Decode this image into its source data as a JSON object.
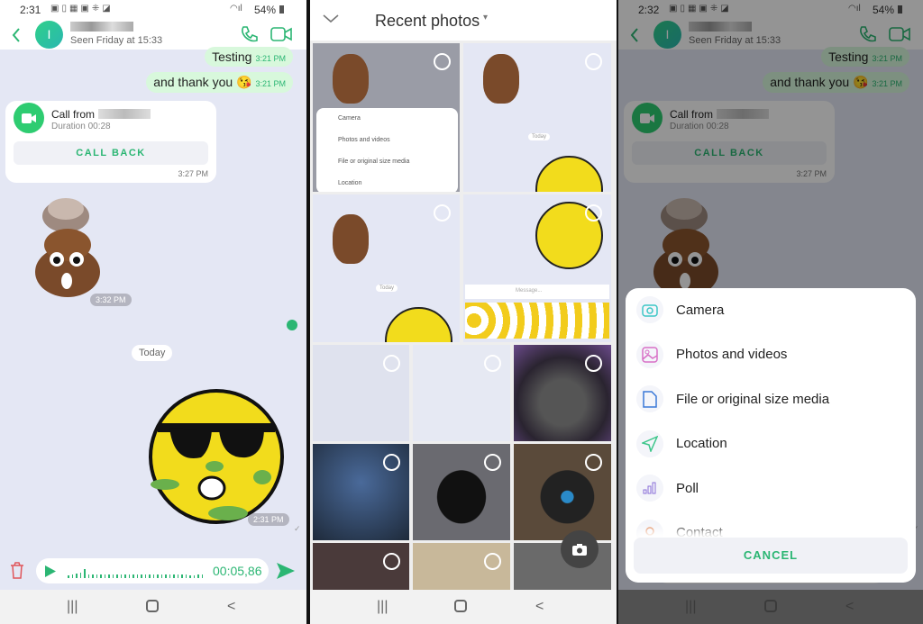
{
  "left": {
    "status": {
      "time": "2:31",
      "battery": "54%"
    },
    "header": {
      "avatar_letter": "I",
      "seen": "Seen Friday at 15:33"
    },
    "messages": [
      {
        "text": "Testing",
        "time": "3:21 PM"
      },
      {
        "text": "and thank you 😘",
        "time": "3:21 PM"
      }
    ],
    "call": {
      "title": "Call from",
      "duration": "Duration 00:28",
      "button": "CALL BACK",
      "time": "3:27 PM"
    },
    "sticker1_time": "3:32 PM",
    "date_divider": "Today",
    "sticker2_time": "2:31 PM",
    "composer": {
      "duration": "00:05,86"
    }
  },
  "middle": {
    "title": "Recent photos",
    "mini_menu": [
      "Camera",
      "Photos and videos",
      "File or original size media",
      "Location"
    ],
    "thumb_today": "Today",
    "thumb_message": "Message..."
  },
  "right": {
    "status": {
      "time": "2:32",
      "battery": "54%"
    },
    "sheet": {
      "items": [
        {
          "label": "Camera",
          "icon": "camera-icon",
          "color": "#3cc6c6"
        },
        {
          "label": "Photos and videos",
          "icon": "image-icon",
          "color": "#d86fc6"
        },
        {
          "label": "File or original size media",
          "icon": "file-icon",
          "color": "#3a78d8"
        },
        {
          "label": "Location",
          "icon": "location-arrow-icon",
          "color": "#3cc68a"
        },
        {
          "label": "Poll",
          "icon": "poll-icon",
          "color": "#8a6fd8"
        },
        {
          "label": "Contact",
          "icon": "contact-icon",
          "color": "#e08a5a"
        }
      ],
      "cancel": "CANCEL"
    }
  },
  "colors": {
    "accent": "#2bb673",
    "bubble": "#d8f8dc",
    "chat_bg": "#e4e7f4"
  }
}
